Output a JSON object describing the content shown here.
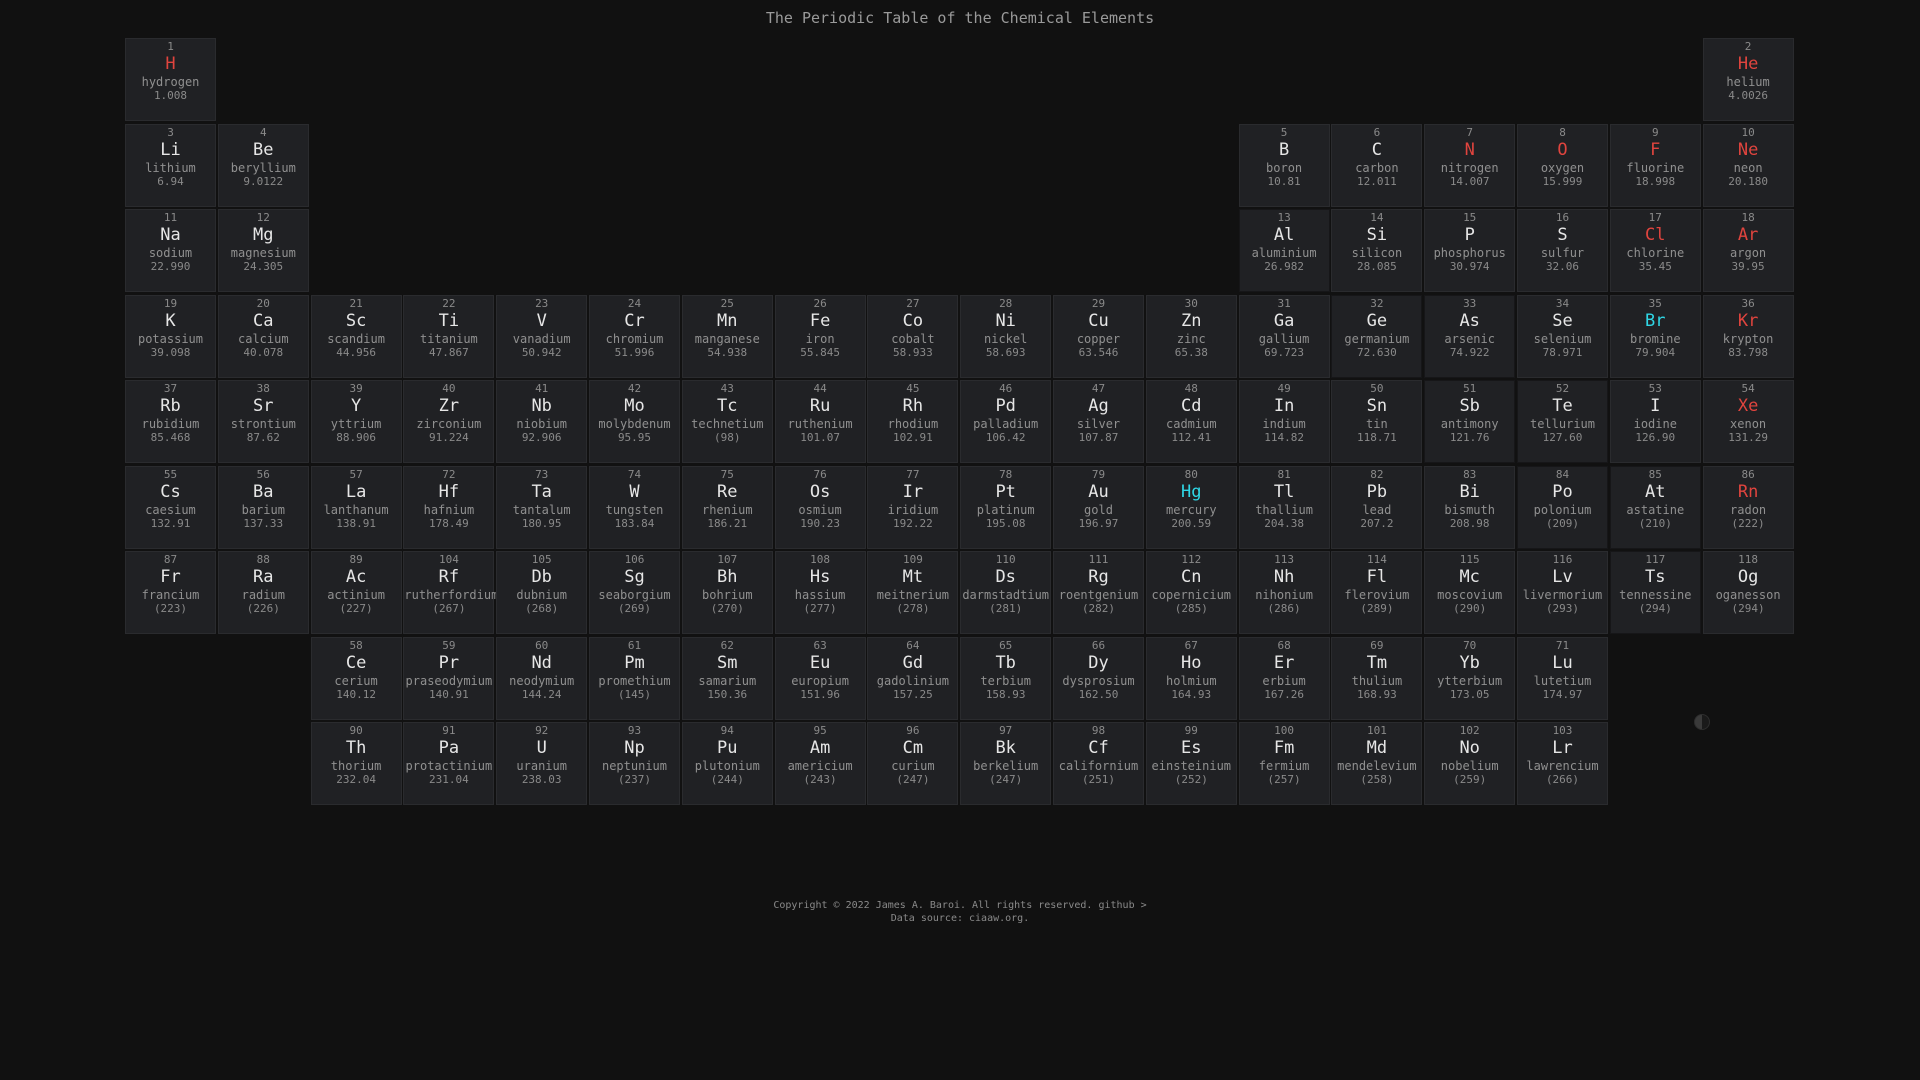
{
  "page": {
    "title": "The Periodic Table of the Chemical Elements"
  },
  "colors": {
    "background": "#111111",
    "cell": "#202124",
    "gas_symbol": "#e0443e",
    "liquid_symbol": "#2fd7e6"
  },
  "elements": [
    {
      "n": "1",
      "s": "H",
      "name": "hydrogen",
      "m": "1.008",
      "row": 1,
      "col": 1,
      "state": "gas"
    },
    {
      "n": "2",
      "s": "He",
      "name": "helium",
      "m": "4.0026",
      "row": 1,
      "col": 18,
      "state": "gas"
    },
    {
      "n": "3",
      "s": "Li",
      "name": "lithium",
      "m": "6.94",
      "row": 2,
      "col": 1
    },
    {
      "n": "4",
      "s": "Be",
      "name": "beryllium",
      "m": "9.0122",
      "row": 2,
      "col": 2
    },
    {
      "n": "5",
      "s": "B",
      "name": "boron",
      "m": "10.81",
      "row": 2,
      "col": 13
    },
    {
      "n": "6",
      "s": "C",
      "name": "carbon",
      "m": "12.011",
      "row": 2,
      "col": 14
    },
    {
      "n": "7",
      "s": "N",
      "name": "nitrogen",
      "m": "14.007",
      "row": 2,
      "col": 15,
      "state": "gas"
    },
    {
      "n": "8",
      "s": "O",
      "name": "oxygen",
      "m": "15.999",
      "row": 2,
      "col": 16,
      "state": "gas"
    },
    {
      "n": "9",
      "s": "F",
      "name": "fluorine",
      "m": "18.998",
      "row": 2,
      "col": 17,
      "state": "gas"
    },
    {
      "n": "10",
      "s": "Ne",
      "name": "neon",
      "m": "20.180",
      "row": 2,
      "col": 18,
      "state": "gas"
    },
    {
      "n": "11",
      "s": "Na",
      "name": "sodium",
      "m": "22.990",
      "row": 3,
      "col": 1
    },
    {
      "n": "12",
      "s": "Mg",
      "name": "magnesium",
      "m": "24.305",
      "row": 3,
      "col": 2
    },
    {
      "n": "13",
      "s": "Al",
      "name": "aluminium",
      "m": "26.982",
      "row": 3,
      "col": 13,
      "outlined": true
    },
    {
      "n": "14",
      "s": "Si",
      "name": "silicon",
      "m": "28.085",
      "row": 3,
      "col": 14
    },
    {
      "n": "15",
      "s": "P",
      "name": "phosphorus",
      "m": "30.974",
      "row": 3,
      "col": 15
    },
    {
      "n": "16",
      "s": "S",
      "name": "sulfur",
      "m": "32.06",
      "row": 3,
      "col": 16
    },
    {
      "n": "17",
      "s": "Cl",
      "name": "chlorine",
      "m": "35.45",
      "row": 3,
      "col": 17,
      "state": "gas"
    },
    {
      "n": "18",
      "s": "Ar",
      "name": "argon",
      "m": "39.95",
      "row": 3,
      "col": 18,
      "state": "gas"
    },
    {
      "n": "19",
      "s": "K",
      "name": "potassium",
      "m": "39.098",
      "row": 4,
      "col": 1
    },
    {
      "n": "20",
      "s": "Ca",
      "name": "calcium",
      "m": "40.078",
      "row": 4,
      "col": 2
    },
    {
      "n": "21",
      "s": "Sc",
      "name": "scandium",
      "m": "44.956",
      "row": 4,
      "col": 3
    },
    {
      "n": "22",
      "s": "Ti",
      "name": "titanium",
      "m": "47.867",
      "row": 4,
      "col": 4
    },
    {
      "n": "23",
      "s": "V",
      "name": "vanadium",
      "m": "50.942",
      "row": 4,
      "col": 5
    },
    {
      "n": "24",
      "s": "Cr",
      "name": "chromium",
      "m": "51.996",
      "row": 4,
      "col": 6
    },
    {
      "n": "25",
      "s": "Mn",
      "name": "manganese",
      "m": "54.938",
      "row": 4,
      "col": 7
    },
    {
      "n": "26",
      "s": "Fe",
      "name": "iron",
      "m": "55.845",
      "row": 4,
      "col": 8
    },
    {
      "n": "27",
      "s": "Co",
      "name": "cobalt",
      "m": "58.933",
      "row": 4,
      "col": 9
    },
    {
      "n": "28",
      "s": "Ni",
      "name": "nickel",
      "m": "58.693",
      "row": 4,
      "col": 10
    },
    {
      "n": "29",
      "s": "Cu",
      "name": "copper",
      "m": "63.546",
      "row": 4,
      "col": 11
    },
    {
      "n": "30",
      "s": "Zn",
      "name": "zinc",
      "m": "65.38",
      "row": 4,
      "col": 12
    },
    {
      "n": "31",
      "s": "Ga",
      "name": "gallium",
      "m": "69.723",
      "row": 4,
      "col": 13
    },
    {
      "n": "32",
      "s": "Ge",
      "name": "germanium",
      "m": "72.630",
      "row": 4,
      "col": 14,
      "outlined": true
    },
    {
      "n": "33",
      "s": "As",
      "name": "arsenic",
      "m": "74.922",
      "row": 4,
      "col": 15,
      "outlined": true
    },
    {
      "n": "34",
      "s": "Se",
      "name": "selenium",
      "m": "78.971",
      "row": 4,
      "col": 16
    },
    {
      "n": "35",
      "s": "Br",
      "name": "bromine",
      "m": "79.904",
      "row": 4,
      "col": 17,
      "state": "liquid"
    },
    {
      "n": "36",
      "s": "Kr",
      "name": "krypton",
      "m": "83.798",
      "row": 4,
      "col": 18,
      "state": "gas"
    },
    {
      "n": "37",
      "s": "Rb",
      "name": "rubidium",
      "m": "85.468",
      "row": 5,
      "col": 1
    },
    {
      "n": "38",
      "s": "Sr",
      "name": "strontium",
      "m": "87.62",
      "row": 5,
      "col": 2
    },
    {
      "n": "39",
      "s": "Y",
      "name": "yttrium",
      "m": "88.906",
      "row": 5,
      "col": 3
    },
    {
      "n": "40",
      "s": "Zr",
      "name": "zirconium",
      "m": "91.224",
      "row": 5,
      "col": 4
    },
    {
      "n": "41",
      "s": "Nb",
      "name": "niobium",
      "m": "92.906",
      "row": 5,
      "col": 5
    },
    {
      "n": "42",
      "s": "Mo",
      "name": "molybdenum",
      "m": "95.95",
      "row": 5,
      "col": 6
    },
    {
      "n": "43",
      "s": "Tc",
      "name": "technetium",
      "m": "(98)",
      "row": 5,
      "col": 7
    },
    {
      "n": "44",
      "s": "Ru",
      "name": "ruthenium",
      "m": "101.07",
      "row": 5,
      "col": 8
    },
    {
      "n": "45",
      "s": "Rh",
      "name": "rhodium",
      "m": "102.91",
      "row": 5,
      "col": 9
    },
    {
      "n": "46",
      "s": "Pd",
      "name": "palladium",
      "m": "106.42",
      "row": 5,
      "col": 10
    },
    {
      "n": "47",
      "s": "Ag",
      "name": "silver",
      "m": "107.87",
      "row": 5,
      "col": 11
    },
    {
      "n": "48",
      "s": "Cd",
      "name": "cadmium",
      "m": "112.41",
      "row": 5,
      "col": 12
    },
    {
      "n": "49",
      "s": "In",
      "name": "indium",
      "m": "114.82",
      "row": 5,
      "col": 13
    },
    {
      "n": "50",
      "s": "Sn",
      "name": "tin",
      "m": "118.71",
      "row": 5,
      "col": 14
    },
    {
      "n": "51",
      "s": "Sb",
      "name": "antimony",
      "m": "121.76",
      "row": 5,
      "col": 15,
      "outlined": true
    },
    {
      "n": "52",
      "s": "Te",
      "name": "tellurium",
      "m": "127.60",
      "row": 5,
      "col": 16,
      "outlined": true
    },
    {
      "n": "53",
      "s": "I",
      "name": "iodine",
      "m": "126.90",
      "row": 5,
      "col": 17
    },
    {
      "n": "54",
      "s": "Xe",
      "name": "xenon",
      "m": "131.29",
      "row": 5,
      "col": 18,
      "state": "gas"
    },
    {
      "n": "55",
      "s": "Cs",
      "name": "caesium",
      "m": "132.91",
      "row": 6,
      "col": 1
    },
    {
      "n": "56",
      "s": "Ba",
      "name": "barium",
      "m": "137.33",
      "row": 6,
      "col": 2
    },
    {
      "n": "57",
      "s": "La",
      "name": "lanthanum",
      "m": "138.91",
      "row": 6,
      "col": 3
    },
    {
      "n": "72",
      "s": "Hf",
      "name": "hafnium",
      "m": "178.49",
      "row": 6,
      "col": 4
    },
    {
      "n": "73",
      "s": "Ta",
      "name": "tantalum",
      "m": "180.95",
      "row": 6,
      "col": 5
    },
    {
      "n": "74",
      "s": "W",
      "name": "tungsten",
      "m": "183.84",
      "row": 6,
      "col": 6
    },
    {
      "n": "75",
      "s": "Re",
      "name": "rhenium",
      "m": "186.21",
      "row": 6,
      "col": 7
    },
    {
      "n": "76",
      "s": "Os",
      "name": "osmium",
      "m": "190.23",
      "row": 6,
      "col": 8
    },
    {
      "n": "77",
      "s": "Ir",
      "name": "iridium",
      "m": "192.22",
      "row": 6,
      "col": 9
    },
    {
      "n": "78",
      "s": "Pt",
      "name": "platinum",
      "m": "195.08",
      "row": 6,
      "col": 10
    },
    {
      "n": "79",
      "s": "Au",
      "name": "gold",
      "m": "196.97",
      "row": 6,
      "col": 11
    },
    {
      "n": "80",
      "s": "Hg",
      "name": "mercury",
      "m": "200.59",
      "row": 6,
      "col": 12,
      "state": "liquid"
    },
    {
      "n": "81",
      "s": "Tl",
      "name": "thallium",
      "m": "204.38",
      "row": 6,
      "col": 13
    },
    {
      "n": "82",
      "s": "Pb",
      "name": "lead",
      "m": "207.2",
      "row": 6,
      "col": 14
    },
    {
      "n": "83",
      "s": "Bi",
      "name": "bismuth",
      "m": "208.98",
      "row": 6,
      "col": 15
    },
    {
      "n": "84",
      "s": "Po",
      "name": "polonium",
      "m": "(209)",
      "row": 6,
      "col": 16,
      "outlined": true
    },
    {
      "n": "85",
      "s": "At",
      "name": "astatine",
      "m": "(210)",
      "row": 6,
      "col": 17,
      "outlined": true
    },
    {
      "n": "86",
      "s": "Rn",
      "name": "radon",
      "m": "(222)",
      "row": 6,
      "col": 18,
      "state": "gas"
    },
    {
      "n": "87",
      "s": "Fr",
      "name": "francium",
      "m": "(223)",
      "row": 7,
      "col": 1
    },
    {
      "n": "88",
      "s": "Ra",
      "name": "radium",
      "m": "(226)",
      "row": 7,
      "col": 2
    },
    {
      "n": "89",
      "s": "Ac",
      "name": "actinium",
      "m": "(227)",
      "row": 7,
      "col": 3
    },
    {
      "n": "104",
      "s": "Rf",
      "name": "rutherfordium",
      "m": "(267)",
      "row": 7,
      "col": 4
    },
    {
      "n": "105",
      "s": "Db",
      "name": "dubnium",
      "m": "(268)",
      "row": 7,
      "col": 5
    },
    {
      "n": "106",
      "s": "Sg",
      "name": "seaborgium",
      "m": "(269)",
      "row": 7,
      "col": 6
    },
    {
      "n": "107",
      "s": "Bh",
      "name": "bohrium",
      "m": "(270)",
      "row": 7,
      "col": 7
    },
    {
      "n": "108",
      "s": "Hs",
      "name": "hassium",
      "m": "(277)",
      "row": 7,
      "col": 8
    },
    {
      "n": "109",
      "s": "Mt",
      "name": "meitnerium",
      "m": "(278)",
      "row": 7,
      "col": 9
    },
    {
      "n": "110",
      "s": "Ds",
      "name": "darmstadtium",
      "m": "(281)",
      "row": 7,
      "col": 10
    },
    {
      "n": "111",
      "s": "Rg",
      "name": "roentgenium",
      "m": "(282)",
      "row": 7,
      "col": 11
    },
    {
      "n": "112",
      "s": "Cn",
      "name": "copernicium",
      "m": "(285)",
      "row": 7,
      "col": 12
    },
    {
      "n": "113",
      "s": "Nh",
      "name": "nihonium",
      "m": "(286)",
      "row": 7,
      "col": 13
    },
    {
      "n": "114",
      "s": "Fl",
      "name": "flerovium",
      "m": "(289)",
      "row": 7,
      "col": 14
    },
    {
      "n": "115",
      "s": "Mc",
      "name": "moscovium",
      "m": "(290)",
      "row": 7,
      "col": 15
    },
    {
      "n": "116",
      "s": "Lv",
      "name": "livermorium",
      "m": "(293)",
      "row": 7,
      "col": 16
    },
    {
      "n": "117",
      "s": "Ts",
      "name": "tennessine",
      "m": "(294)",
      "row": 7,
      "col": 17,
      "outlined": true
    },
    {
      "n": "118",
      "s": "Og",
      "name": "oganesson",
      "m": "(294)",
      "row": 7,
      "col": 18
    },
    {
      "n": "58",
      "s": "Ce",
      "name": "cerium",
      "m": "140.12",
      "row": 8,
      "col": 3
    },
    {
      "n": "59",
      "s": "Pr",
      "name": "praseodymium",
      "m": "140.91",
      "row": 8,
      "col": 4
    },
    {
      "n": "60",
      "s": "Nd",
      "name": "neodymium",
      "m": "144.24",
      "row": 8,
      "col": 5
    },
    {
      "n": "61",
      "s": "Pm",
      "name": "promethium",
      "m": "(145)",
      "row": 8,
      "col": 6
    },
    {
      "n": "62",
      "s": "Sm",
      "name": "samarium",
      "m": "150.36",
      "row": 8,
      "col": 7
    },
    {
      "n": "63",
      "s": "Eu",
      "name": "europium",
      "m": "151.96",
      "row": 8,
      "col": 8
    },
    {
      "n": "64",
      "s": "Gd",
      "name": "gadolinium",
      "m": "157.25",
      "row": 8,
      "col": 9
    },
    {
      "n": "65",
      "s": "Tb",
      "name": "terbium",
      "m": "158.93",
      "row": 8,
      "col": 10
    },
    {
      "n": "66",
      "s": "Dy",
      "name": "dysprosium",
      "m": "162.50",
      "row": 8,
      "col": 11
    },
    {
      "n": "67",
      "s": "Ho",
      "name": "holmium",
      "m": "164.93",
      "row": 8,
      "col": 12
    },
    {
      "n": "68",
      "s": "Er",
      "name": "erbium",
      "m": "167.26",
      "row": 8,
      "col": 13
    },
    {
      "n": "69",
      "s": "Tm",
      "name": "thulium",
      "m": "168.93",
      "row": 8,
      "col": 14
    },
    {
      "n": "70",
      "s": "Yb",
      "name": "ytterbium",
      "m": "173.05",
      "row": 8,
      "col": 15
    },
    {
      "n": "71",
      "s": "Lu",
      "name": "lutetium",
      "m": "174.97",
      "row": 8,
      "col": 16
    },
    {
      "n": "90",
      "s": "Th",
      "name": "thorium",
      "m": "232.04",
      "row": 9,
      "col": 3
    },
    {
      "n": "91",
      "s": "Pa",
      "name": "protactinium",
      "m": "231.04",
      "row": 9,
      "col": 4
    },
    {
      "n": "92",
      "s": "U",
      "name": "uranium",
      "m": "238.03",
      "row": 9,
      "col": 5
    },
    {
      "n": "93",
      "s": "Np",
      "name": "neptunium",
      "m": "(237)",
      "row": 9,
      "col": 6
    },
    {
      "n": "94",
      "s": "Pu",
      "name": "plutonium",
      "m": "(244)",
      "row": 9,
      "col": 7
    },
    {
      "n": "95",
      "s": "Am",
      "name": "americium",
      "m": "(243)",
      "row": 9,
      "col": 8
    },
    {
      "n": "96",
      "s": "Cm",
      "name": "curium",
      "m": "(247)",
      "row": 9,
      "col": 9
    },
    {
      "n": "97",
      "s": "Bk",
      "name": "berkelium",
      "m": "(247)",
      "row": 9,
      "col": 10
    },
    {
      "n": "98",
      "s": "Cf",
      "name": "californium",
      "m": "(251)",
      "row": 9,
      "col": 11
    },
    {
      "n": "99",
      "s": "Es",
      "name": "einsteinium",
      "m": "(252)",
      "row": 9,
      "col": 12
    },
    {
      "n": "100",
      "s": "Fm",
      "name": "fermium",
      "m": "(257)",
      "row": 9,
      "col": 13
    },
    {
      "n": "101",
      "s": "Md",
      "name": "mendelevium",
      "m": "(258)",
      "row": 9,
      "col": 14
    },
    {
      "n": "102",
      "s": "No",
      "name": "nobelium",
      "m": "(259)",
      "row": 9,
      "col": 15
    },
    {
      "n": "103",
      "s": "Lr",
      "name": "lawrencium",
      "m": "(266)",
      "row": 9,
      "col": 16
    }
  ],
  "theme_toggle": {
    "icon": "half-circle-contrast-icon"
  },
  "footer": {
    "copyright": "Copyright © 2022 James A. Baroi. All rights reserved.",
    "github_link": "github >",
    "data_source": "Data source: ciaaw.org."
  }
}
